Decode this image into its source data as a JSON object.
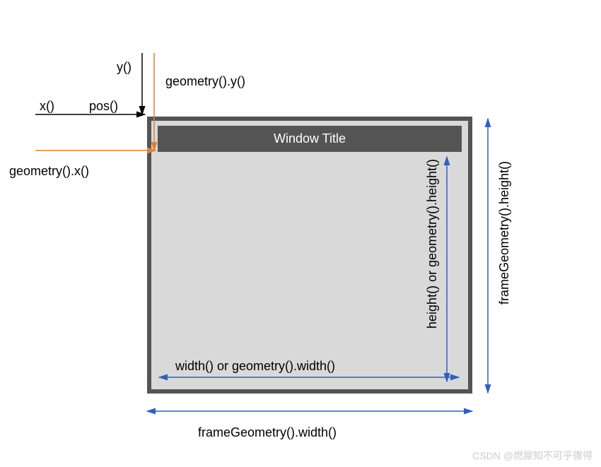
{
  "labels": {
    "y": "y()",
    "x": "x()",
    "pos": "pos()",
    "geom_y": "geometry().y()",
    "geom_x": "geometry().x()",
    "window_title": "Window Title",
    "width_label": "width() or geometry().width()",
    "height_label": "height() or geometry().height()",
    "frame_width": "frameGeometry().width()",
    "frame_height": "frameGeometry().height()",
    "watermark": "CSDN @燃犀知不可乎骤得"
  }
}
